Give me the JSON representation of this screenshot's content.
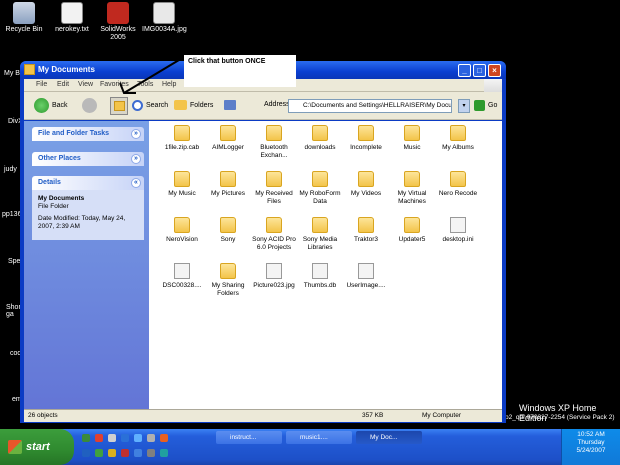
{
  "desktop": {
    "icons": [
      {
        "label": "Recycle Bin"
      },
      {
        "label": "nerokey.txt"
      },
      {
        "label": "SolidWorks 2005"
      },
      {
        "label": "IMG0034A.jpg"
      }
    ],
    "left_labels": [
      "My Bl",
      "DivX",
      "judy",
      "pp136",
      "Spe",
      "Shor ga",
      "cod",
      "em"
    ],
    "watermark_line1": "Windows XP Home Edition",
    "watermark_line2": "p2_qdr.070227-2254 (Service Pack 2)"
  },
  "callout_text": "Click that button ONCE",
  "window": {
    "title": "My Documents",
    "menu": [
      "File",
      "Edit",
      "View",
      "Favorites",
      "Tools",
      "Help"
    ],
    "toolbar": {
      "back": "Back",
      "search": "Search",
      "folders": "Folders"
    },
    "address_label": "Address",
    "address_value": "C:\\Documents and Settings\\HELLRAISER\\My Docu",
    "go": "Go",
    "sidebar": {
      "tasks": "File and Folder Tasks",
      "places": "Other Places",
      "details": "Details",
      "details_name": "My Documents",
      "details_type": "File Folder",
      "details_modified": "Date Modified: Today, May 24, 2007, 2:39 AM"
    },
    "items": [
      {
        "label": "1file.zip.cab",
        "kind": "folder"
      },
      {
        "label": "AIMLogger",
        "kind": "folder"
      },
      {
        "label": "Bluetooth Exchan...",
        "kind": "folder"
      },
      {
        "label": "downloads",
        "kind": "folder"
      },
      {
        "label": "Incomplete",
        "kind": "folder"
      },
      {
        "label": "Music",
        "kind": "folder"
      },
      {
        "label": "My Albums",
        "kind": "folder"
      },
      {
        "label": "My Music",
        "kind": "folder"
      },
      {
        "label": "My Pictures",
        "kind": "folder"
      },
      {
        "label": "My Received Files",
        "kind": "folder"
      },
      {
        "label": "My RoboForm Data",
        "kind": "folder"
      },
      {
        "label": "My Videos",
        "kind": "folder"
      },
      {
        "label": "My Virtual Machines",
        "kind": "folder"
      },
      {
        "label": "Nero Recode",
        "kind": "folder"
      },
      {
        "label": "NeroVision",
        "kind": "folder"
      },
      {
        "label": "Sony",
        "kind": "folder"
      },
      {
        "label": "Sony ACID Pro 6.0 Projects",
        "kind": "folder"
      },
      {
        "label": "Sony Media Libraries",
        "kind": "folder"
      },
      {
        "label": "Traktor3",
        "kind": "folder"
      },
      {
        "label": "Updater5",
        "kind": "folder"
      },
      {
        "label": "desktop.ini",
        "kind": "file"
      },
      {
        "label": "DSC00328....",
        "kind": "file"
      },
      {
        "label": "My Sharing Folders",
        "kind": "folder"
      },
      {
        "label": "Picture023.jpg",
        "kind": "file"
      },
      {
        "label": "Thumbs.db",
        "kind": "file"
      },
      {
        "label": "UserImage....",
        "kind": "file"
      }
    ],
    "status": {
      "objects": "26 objects",
      "size": "357 KB",
      "location": "My Computer"
    }
  },
  "taskbar": {
    "start": "start",
    "tasks": [
      "instruct...",
      "music1....",
      "My Doc..."
    ],
    "clock_time": "10:52 AM",
    "clock_day": "Thursday",
    "clock_date": "5/24/2007"
  },
  "colors": {
    "title_blue": "#0a3fd0",
    "panel_blue": "#6375d6",
    "start_green": "#2f8a2f"
  }
}
